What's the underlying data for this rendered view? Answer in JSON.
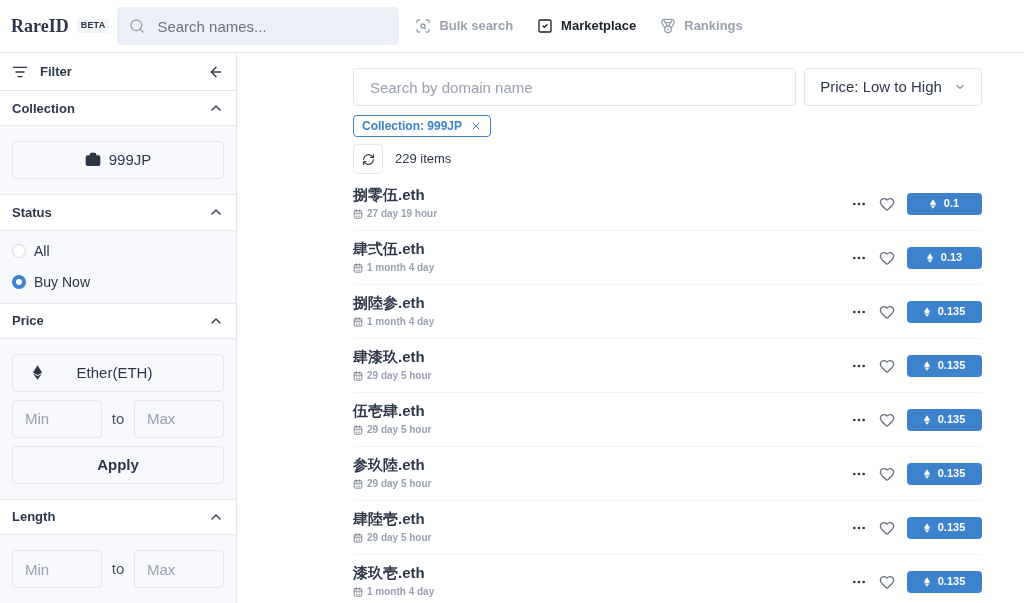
{
  "header": {
    "logo": "RareID",
    "badge": "BETA",
    "search": {
      "placeholder": "Search names..."
    },
    "nav": [
      {
        "kind": "bulk",
        "label": "Bulk search",
        "selected": false
      },
      {
        "kind": "market",
        "label": "Marketplace",
        "selected": true
      },
      {
        "kind": "rank",
        "label": "Rankings",
        "selected": false
      }
    ]
  },
  "sidebar": {
    "title": "Filter",
    "collection": {
      "title": "Collection",
      "expanded": true,
      "value": "999JP"
    },
    "status": {
      "title": "Status",
      "expanded": true,
      "options": [
        {
          "label": "All",
          "selected": false
        },
        {
          "label": "Buy Now",
          "selected": true
        }
      ]
    },
    "price": {
      "title": "Price",
      "expanded": true,
      "currency": "Ether(ETH)",
      "min": {
        "placeholder": "Min"
      },
      "to": "to",
      "max": {
        "placeholder": "Max"
      },
      "apply": "Apply"
    },
    "length": {
      "title": "Length",
      "expanded": true,
      "min": {
        "placeholder": "Min"
      },
      "to": "to",
      "max": {
        "placeholder": "Max"
      }
    }
  },
  "main": {
    "search": {
      "placeholder": "Search by domain name"
    },
    "sort": "Price: Low to High",
    "chip": "Collection: 999JP",
    "count": "229 items",
    "rows": [
      {
        "name": "捌零伍.eth",
        "time": "27 day 19 hour",
        "price": "0.1"
      },
      {
        "name": "肆弍伍.eth",
        "time": "1 month 4 day",
        "price": "0.13"
      },
      {
        "name": "捌陸参.eth",
        "time": "1 month 4 day",
        "price": "0.135"
      },
      {
        "name": "肆漆玖.eth",
        "time": "29 day 5 hour",
        "price": "0.135"
      },
      {
        "name": "伍壱肆.eth",
        "time": "29 day 5 hour",
        "price": "0.135"
      },
      {
        "name": "参玖陸.eth",
        "time": "29 day 5 hour",
        "price": "0.135"
      },
      {
        "name": "肆陸壱.eth",
        "time": "29 day 5 hour",
        "price": "0.135"
      },
      {
        "name": "漆玖壱.eth",
        "time": "1 month 4 day",
        "price": "0.135"
      }
    ]
  }
}
